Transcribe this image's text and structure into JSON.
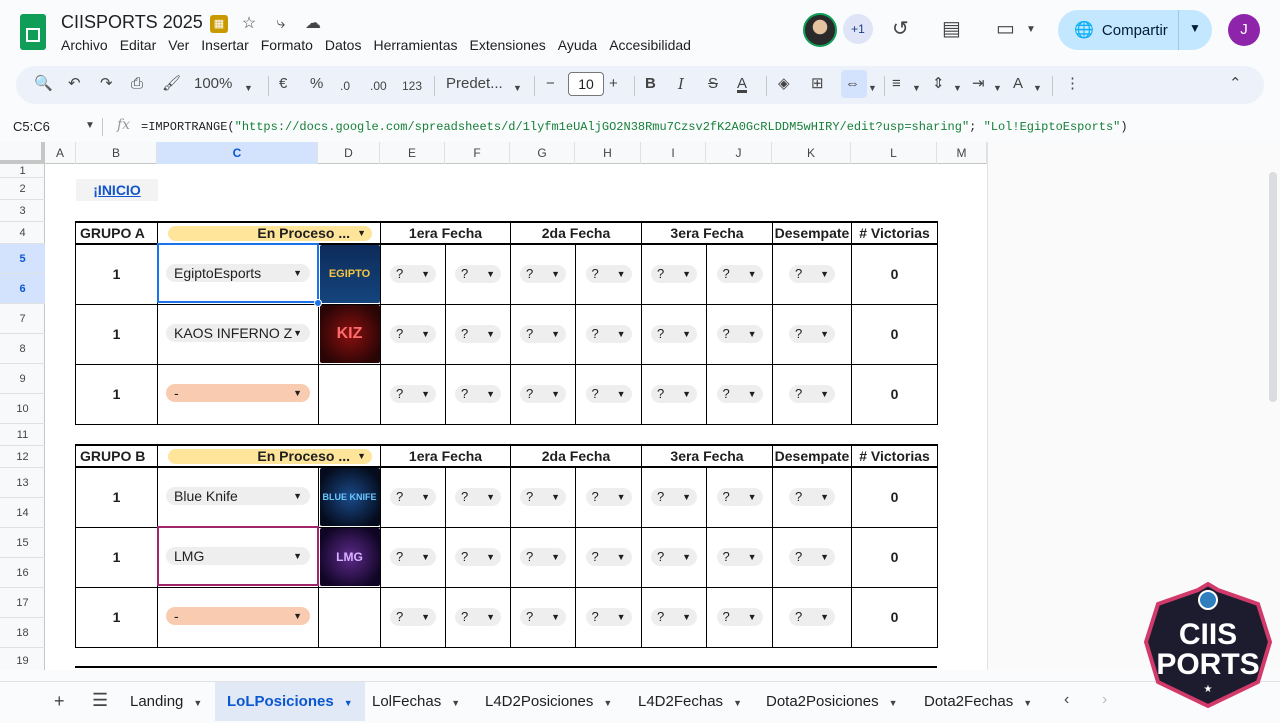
{
  "app": {
    "doc_title": "CIISPORTS 2025",
    "menu": [
      "Archivo",
      "Editar",
      "Ver",
      "Insertar",
      "Formato",
      "Datos",
      "Herramientas",
      "Extensiones",
      "Ayuda",
      "Accesibilidad"
    ],
    "share_label": "Compartir",
    "plus_count": "+1",
    "user_initial": "J"
  },
  "toolbar": {
    "zoom": "100%",
    "currency": "€",
    "percent": "%",
    "dec_less": ".0",
    "dec_more": ".00",
    "number_format": "123",
    "font": "Predet...",
    "font_size": "10"
  },
  "formula_bar": {
    "name_box": "C5:C6",
    "formula_prefix": "=IMPORTRANGE(",
    "formula_arg1": "\"https://docs.google.com/spreadsheets/d/1lyfm1eUAljGO2N38Rmu7Czsv2fK2A0GcRLDDM5wHIRY/edit?usp=sharing\"",
    "formula_sep": "; ",
    "formula_arg2": "\"Lol!EgiptoEsports\"",
    "formula_suffix": ")"
  },
  "columns": [
    "A",
    "B",
    "C",
    "D",
    "E",
    "F",
    "G",
    "H",
    "I",
    "J",
    "K",
    "L",
    "M"
  ],
  "rows": [
    "1",
    "2",
    "3",
    "4",
    "5",
    "6",
    "7",
    "8",
    "9",
    "10",
    "11",
    "12",
    "13",
    "14",
    "15",
    "16",
    "17",
    "18",
    "19"
  ],
  "sheet": {
    "inicio_link": "¡INICIO",
    "headers": {
      "fecha1": "1era Fecha",
      "fecha2": "2da Fecha",
      "fecha3": "3era Fecha",
      "desempate": "Desempate",
      "victorias": "# Victorias"
    },
    "group_a": {
      "name": "GRUPO A",
      "status": "En Proceso ...",
      "rows": [
        {
          "pos": "1",
          "team": "EgiptoEsports",
          "logo": "EGIPTO",
          "picks": [
            "?",
            "?",
            "?",
            "?",
            "?",
            "?",
            "?"
          ],
          "wins": "0"
        },
        {
          "pos": "1",
          "team": "KAOS INFERNO Z",
          "logo": "KIZ",
          "picks": [
            "?",
            "?",
            "?",
            "?",
            "?",
            "?",
            "?"
          ],
          "wins": "0"
        },
        {
          "pos": "1",
          "team": "-",
          "logo": "",
          "picks": [
            "?",
            "?",
            "?",
            "?",
            "?",
            "?",
            "?"
          ],
          "wins": "0"
        }
      ]
    },
    "group_b": {
      "name": "GRUPO B",
      "status": "En Proceso ...",
      "rows": [
        {
          "pos": "1",
          "team": "Blue Knife",
          "logo": "BLUE KNIFE",
          "picks": [
            "?",
            "?",
            "?",
            "?",
            "?",
            "?",
            "?"
          ],
          "wins": "0"
        },
        {
          "pos": "1",
          "team": "LMG",
          "logo": "LMG",
          "picks": [
            "?",
            "?",
            "?",
            "?",
            "?",
            "?",
            "?"
          ],
          "wins": "0"
        },
        {
          "pos": "1",
          "team": "-",
          "logo": "",
          "picks": [
            "?",
            "?",
            "?",
            "?",
            "?",
            "?",
            "?"
          ],
          "wins": "0"
        }
      ]
    }
  },
  "tabs": [
    "Landing",
    "LoLPosiciones",
    "LolFechas",
    "L4D2Posiciones",
    "L4D2Fechas",
    "Dota2Posiciones",
    "Dota2Fechas"
  ],
  "active_tab": "LoLPosiciones",
  "watermark": "CIIS PORTS"
}
